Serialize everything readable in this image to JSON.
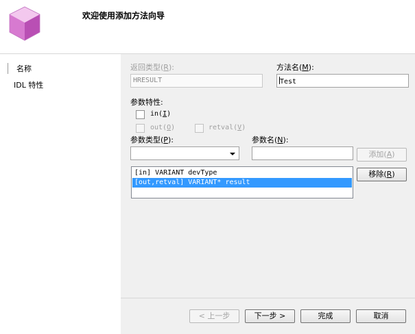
{
  "header": {
    "title": "欢迎使用添加方法向导"
  },
  "nav": {
    "items": [
      {
        "label": "名称"
      },
      {
        "label": "IDL 特性"
      }
    ]
  },
  "form": {
    "return_type": {
      "label": "返回类型(",
      "key": "R",
      "suffix": "):",
      "value": "HRESULT"
    },
    "method_name": {
      "label": "方法名(",
      "key": "M",
      "suffix": "):",
      "value": "Test"
    },
    "param_attrs": {
      "label": "参数特性:"
    },
    "in_attr": {
      "label": "in(",
      "key": "I",
      "suffix": ")"
    },
    "out_attr": {
      "label": "out(",
      "key": "O",
      "suffix": ")"
    },
    "retval_attr": {
      "label": "retval(",
      "key": "V",
      "suffix": ")"
    },
    "param_type": {
      "label": "参数类型(",
      "key": "P",
      "suffix": "):",
      "value": ""
    },
    "param_name": {
      "label": "参数名(",
      "key": "N",
      "suffix": "):",
      "value": ""
    },
    "add_button": {
      "label": "添加(",
      "key": "A",
      "suffix": ")"
    },
    "remove_button": {
      "label": "移除(",
      "key": "R",
      "suffix": ")"
    },
    "params_list": [
      {
        "text": "[in] VARIANT devType",
        "selected": false
      },
      {
        "text": "[out,retval] VARIANT* result",
        "selected": true
      }
    ]
  },
  "footer": {
    "back": "< 上一步",
    "next": "下一步 >",
    "finish": "完成",
    "cancel": "取消"
  },
  "colors": {
    "selection": "#3399ff",
    "panel": "#f0f0f0"
  }
}
